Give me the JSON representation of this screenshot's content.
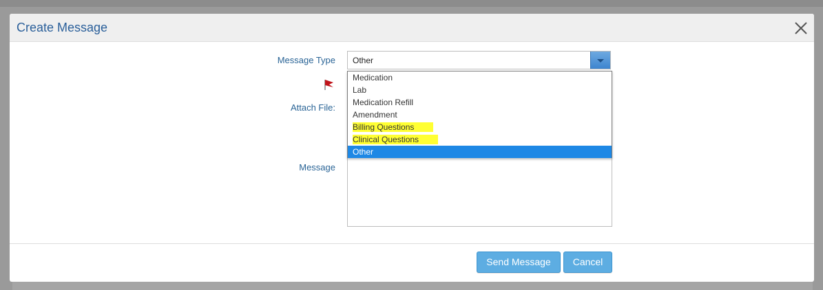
{
  "modal": {
    "title": "Create Message",
    "close_icon": "close-icon"
  },
  "form": {
    "message_type_label": "Message Type",
    "attach_file_label": "Attach File:",
    "message_label": "Message",
    "flag_icon": "flag-icon",
    "selected_type": "Other",
    "dropdown_arrow_icon": "chevron-down-icon",
    "type_options": [
      {
        "label": "Medication",
        "highlighted": false,
        "selected": false
      },
      {
        "label": "Lab",
        "highlighted": false,
        "selected": false
      },
      {
        "label": "Medication Refill",
        "highlighted": false,
        "selected": false
      },
      {
        "label": "Amendment",
        "highlighted": false,
        "selected": false
      },
      {
        "label": "Billing Questions",
        "highlighted": true,
        "selected": false
      },
      {
        "label": "Clinical Questions",
        "highlighted": true,
        "selected": false
      },
      {
        "label": "Other",
        "highlighted": false,
        "selected": true
      }
    ],
    "message_value": ""
  },
  "footer": {
    "send_label": "Send Message",
    "cancel_label": "Cancel"
  },
  "colors": {
    "title": "#2a5f9a",
    "label": "#2a6496",
    "highlight": "#ffff33",
    "selected": "#1e88e5",
    "button": "#5dade2"
  }
}
